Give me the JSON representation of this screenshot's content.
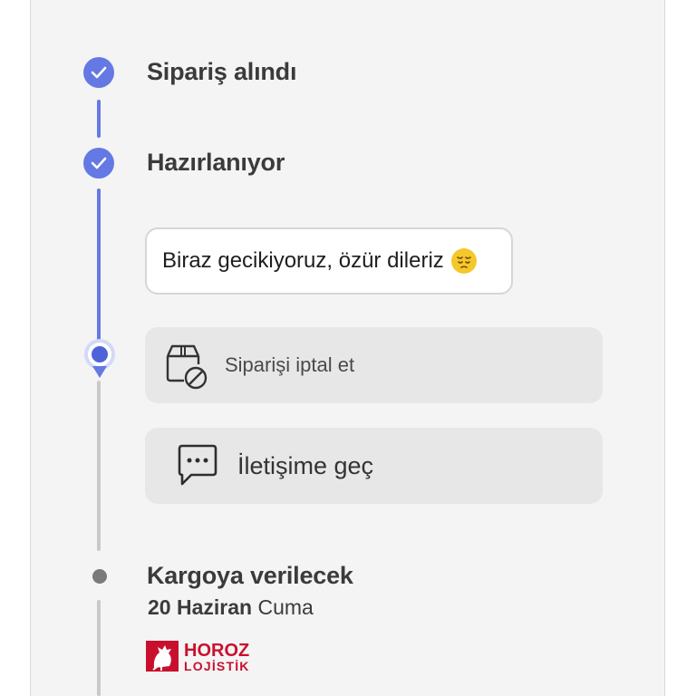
{
  "colors": {
    "accent": "#6479e3",
    "panel_bg": "#f4f4f4",
    "button_bg": "#e7e7e7",
    "inactive_line": "#c9c9c9",
    "brand_red": "#c8102e"
  },
  "timeline": {
    "steps": [
      {
        "label": "Sipariş alındı",
        "status": "completed",
        "icon": "check-icon"
      },
      {
        "label": "Hazırlanıyor",
        "status": "completed",
        "icon": "check-icon"
      },
      {
        "label": "",
        "status": "current",
        "icon": "current-location-icon"
      },
      {
        "label": "Kargoya verilecek",
        "status": "pending",
        "icon": "dot-icon"
      }
    ]
  },
  "delay_message": {
    "text": "Biraz gecikiyoruz, özür dileriz",
    "emoji": "pensive-face-emoji"
  },
  "actions": {
    "cancel": {
      "label": "Siparişi iptal et",
      "icon": "cancel-package-icon"
    },
    "contact": {
      "label": "İletişime geç",
      "icon": "chat-bubble-icon"
    }
  },
  "delivery": {
    "date": "20 Haziran",
    "weekday": "Cuma",
    "carrier": {
      "line1": "HOROZ",
      "line2": "LOJİSTİK"
    }
  }
}
